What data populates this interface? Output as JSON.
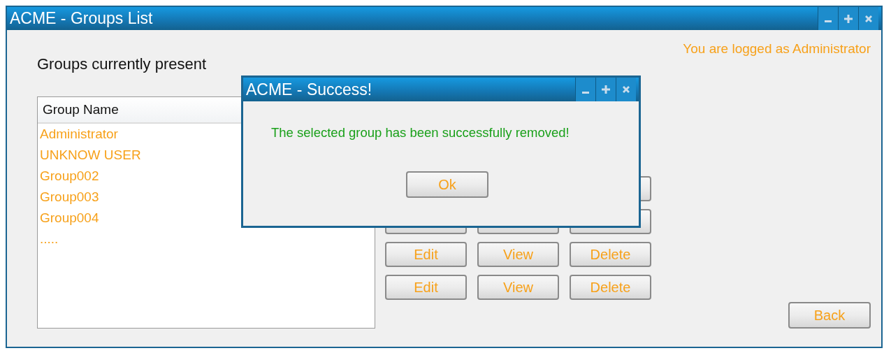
{
  "window": {
    "title": "ACME - Groups List"
  },
  "heading": "Groups currently present",
  "login_status": "You are logged as Administrator",
  "groups_table": {
    "columns": [
      "Group Name"
    ],
    "rows": [
      "Administrator",
      "UNKNOW USER",
      "Group002",
      "Group003",
      "Group004",
      "....."
    ]
  },
  "action_rows": [
    {
      "kind": "covered_left"
    },
    {
      "kind": "covered"
    },
    {
      "kind": "labeled",
      "labels": [
        "Edit",
        "View",
        "Delete"
      ]
    },
    {
      "kind": "labeled",
      "labels": [
        "Edit",
        "View",
        "Delete"
      ]
    }
  ],
  "back_button": "Back",
  "dialog": {
    "title": "ACME - Success!",
    "message": "The selected group has been successfully removed!",
    "button": "Ok"
  }
}
